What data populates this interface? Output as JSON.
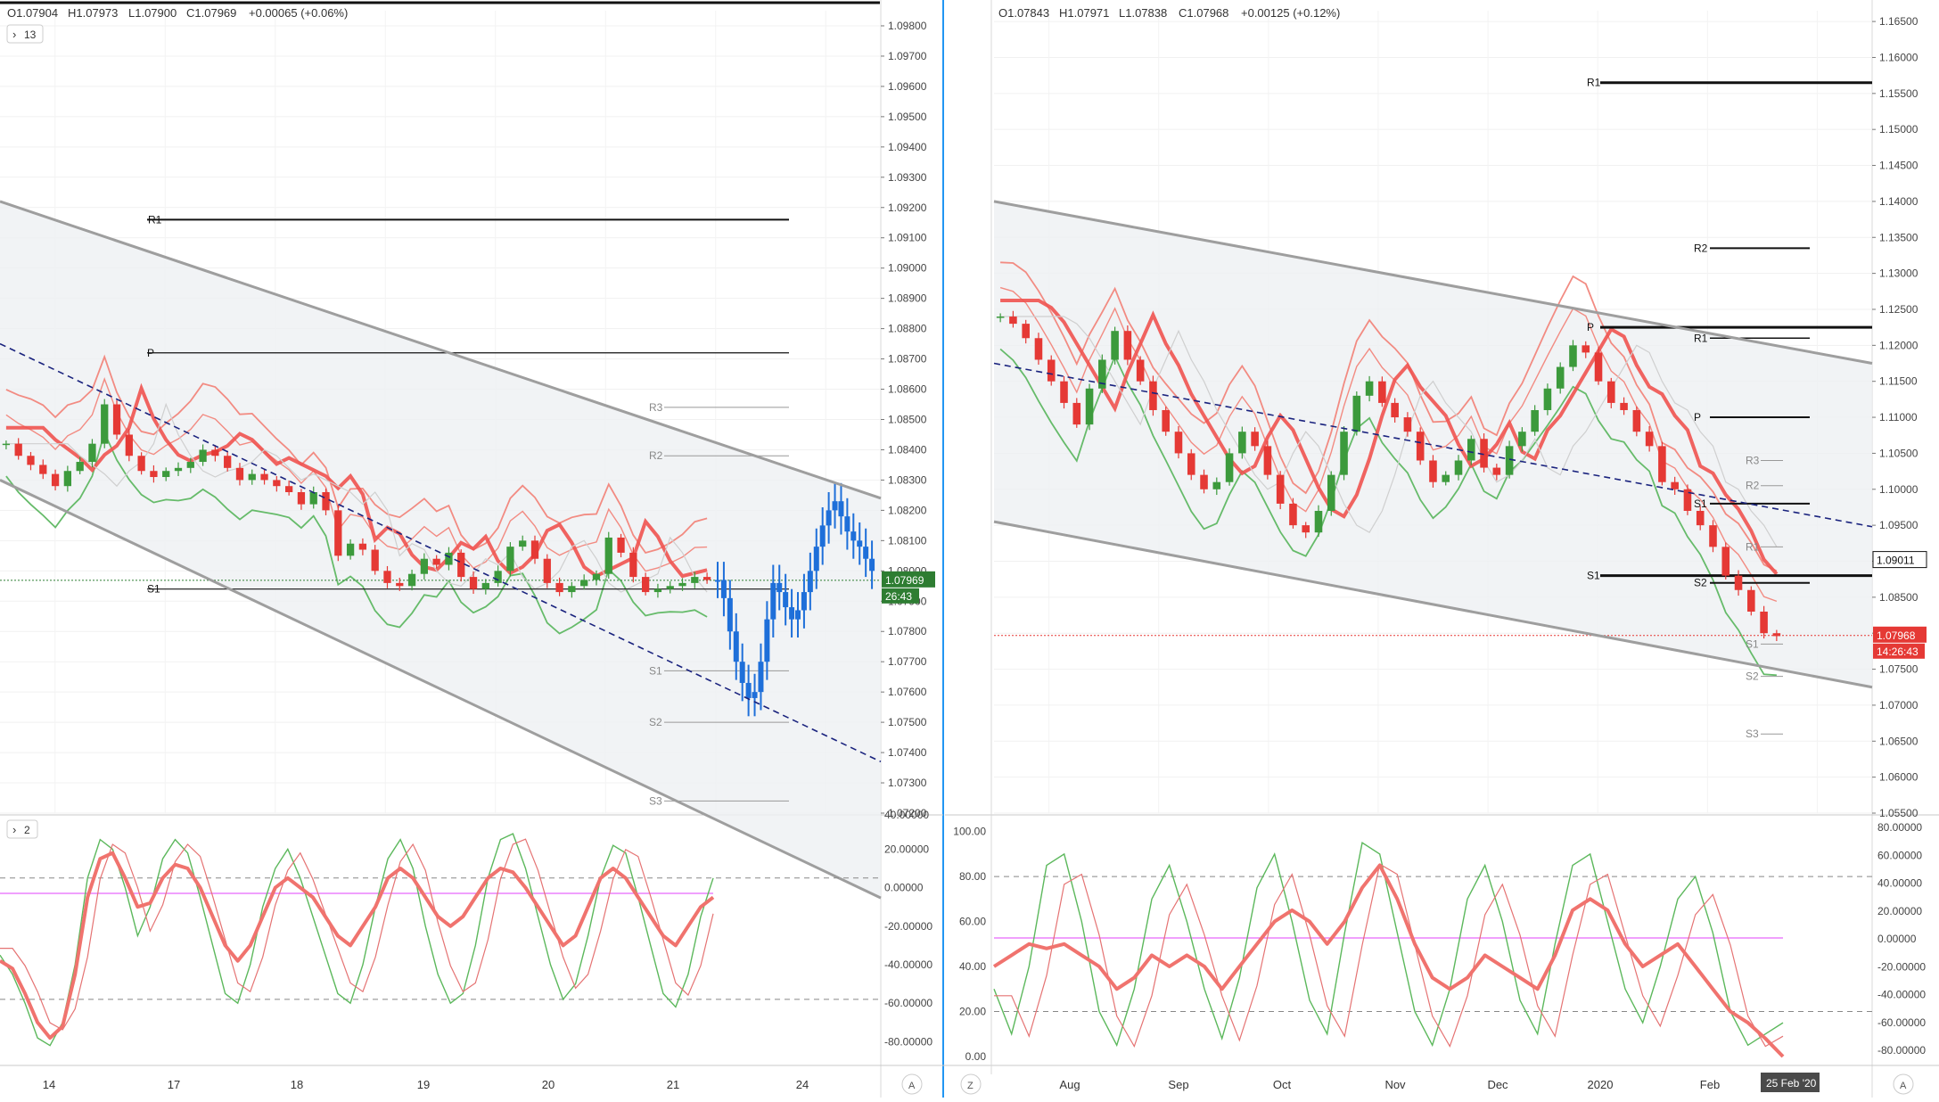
{
  "colors": {
    "bull": "#3c9a3c",
    "bear": "#e53935",
    "blue_bar": "#1e6fd9",
    "ma_red": "#ef5350",
    "band_red": "#f28b82",
    "band_green": "#66bb6a",
    "channel": "#9e9e9e",
    "dashed_trend": "#1a237e",
    "fill": "#eef0f3",
    "osc_fast": "#5cb85c",
    "osc_slow": "#e57373",
    "osc_thick": "#f0736e",
    "last_price_green": "#2e7d32",
    "last_price_red": "#e53935",
    "magenta": "#e040fb"
  },
  "left_panel": {
    "ohlc": {
      "o": "O1.07904",
      "h": "H1.07973",
      "l": "L1.07900",
      "c": "C1.07969",
      "chg": "+0.00065 (+0.06%)"
    },
    "indicator_collapse_label": "13",
    "price_axis_labels": [
      "1.09800",
      "1.09700",
      "1.09600",
      "1.09500",
      "1.09400",
      "1.09300",
      "1.09200",
      "1.09100",
      "1.09000",
      "1.08900",
      "1.08800",
      "1.08700",
      "1.08600",
      "1.08500",
      "1.08400",
      "1.08300",
      "1.08200",
      "1.08100",
      "1.08000",
      "1.07900",
      "1.07800",
      "1.07700",
      "1.07600",
      "1.07500",
      "1.07400",
      "1.07300",
      "1.07200"
    ],
    "last_price": "1.07969",
    "countdown": "26:43",
    "pivot_labels": {
      "r1": "R1",
      "p": "P",
      "s1": "S1",
      "r3": "R3",
      "r2": "R2",
      "s1b": "S1",
      "s2": "S2",
      "s3": "S3"
    },
    "oscillator": {
      "collapse_label": "2",
      "axis_labels": [
        "20.00000",
        "0.00000",
        "-20.00000",
        "-40.00000",
        "-60.00000",
        "-80.00000"
      ],
      "top_edge_label": "40.00000"
    },
    "time_labels": [
      "14",
      "17",
      "18",
      "19",
      "20",
      "21",
      "24"
    ],
    "auto_button": "A"
  },
  "right_panel": {
    "ohlc": {
      "o": "O1.07843",
      "h": "H1.07971",
      "l": "L1.07838",
      "c": "C1.07968",
      "chg": "+0.00125 (+0.12%)"
    },
    "price_axis_labels": [
      "1.16500",
      "1.16000",
      "1.15500",
      "1.15000",
      "1.14500",
      "1.14000",
      "1.13500",
      "1.13000",
      "1.12500",
      "1.12000",
      "1.11500",
      "1.11000",
      "1.10500",
      "1.10000",
      "1.09500",
      "1.09000",
      "1.08500",
      "1.08000",
      "1.07500",
      "1.07000",
      "1.06500",
      "1.06000",
      "1.05500"
    ],
    "marker_price": "1.09011",
    "last_price": "1.07968",
    "countdown": "14:26:43",
    "pivot_labels": {
      "r1": "R1",
      "r2": "R2",
      "p": "P",
      "r1b": "R1",
      "p2": "P",
      "r3": "R3",
      "r2b": "R2",
      "s1": "S1",
      "r1c": "R1",
      "s1b": "S1",
      "s2": "S2",
      "s1c": "S1",
      "s2b": "S2",
      "s3": "S3"
    },
    "oscillator": {
      "left_axis_labels": [
        "100.00",
        "80.00",
        "60.00",
        "40.00",
        "20.00",
        "0.00"
      ],
      "right_axis_labels": [
        "80.00000",
        "60.00000",
        "40.00000",
        "20.00000",
        "0.00000",
        "-20.00000",
        "-40.00000",
        "-60.00000",
        "-80.00000"
      ]
    },
    "time_labels": [
      "Aug",
      "Sep",
      "Oct",
      "Nov",
      "Dec",
      "2020",
      "Feb"
    ],
    "date_marker": "25 Feb '20",
    "z_button": "Z",
    "auto_button": "A"
  },
  "chart_data": [
    {
      "type": "candlestick",
      "title": "",
      "timeframe_labels": [
        "14",
        "17",
        "18",
        "19",
        "20",
        "21",
        "24"
      ],
      "ylim": [
        1.072,
        1.0985
      ],
      "last_price": 1.07969,
      "pivots": {
        "R1": 1.0916,
        "P": 1.0872,
        "S1": 1.0794,
        "R3": 1.0854,
        "R2": 1.0838,
        "S1_weekly": 1.0767,
        "S2": 1.075,
        "S3": 1.0724
      },
      "channel_upper": [
        [
          0.0,
          1.0922
        ],
        [
          1.0,
          1.0824
        ]
      ],
      "channel_lower": [
        [
          0.0,
          1.083
        ],
        [
          1.0,
          1.0692
        ]
      ],
      "trend_dashed": [
        [
          0.0,
          1.0875
        ],
        [
          1.0,
          1.0737
        ]
      ],
      "close_path": [
        1.0842,
        1.0838,
        1.0835,
        1.0832,
        1.0828,
        1.0833,
        1.0836,
        1.0842,
        1.0855,
        1.0845,
        1.0838,
        1.0833,
        1.0831,
        1.0833,
        1.0834,
        1.0836,
        1.084,
        1.0838,
        1.0834,
        1.083,
        1.0832,
        1.083,
        1.0828,
        1.0826,
        1.0822,
        1.0826,
        1.082,
        1.0805,
        1.0809,
        1.0807,
        1.08,
        1.0796,
        1.0795,
        1.0799,
        1.0804,
        1.0802,
        1.0806,
        1.0798,
        1.0794,
        1.0796,
        1.08,
        1.0808,
        1.081,
        1.0804,
        1.0796,
        1.0793,
        1.0795,
        1.0797,
        1.0799,
        1.0811,
        1.0806,
        1.0798,
        1.0793,
        1.0794,
        1.0795,
        1.0796,
        1.0798,
        1.0797
      ],
      "projection_path": [
        1.0797,
        1.0791,
        1.078,
        1.077,
        1.0763,
        1.0758,
        1.076,
        1.077,
        1.0784,
        1.0796,
        1.0793,
        1.0788,
        1.0784,
        1.0787,
        1.0793,
        1.08,
        1.0808,
        1.0815,
        1.082,
        1.0823,
        1.0818,
        1.0813,
        1.081,
        1.0808,
        1.0804,
        1.08
      ],
      "oscillator": {
        "ylim": [
          -90,
          35
        ],
        "levels": [
          5,
          -58
        ],
        "fast": [
          -35,
          -45,
          -60,
          -78,
          -82,
          -70,
          -40,
          5,
          25,
          20,
          0,
          -25,
          -10,
          15,
          25,
          18,
          -5,
          -30,
          -55,
          -60,
          -40,
          -10,
          10,
          20,
          5,
          -15,
          -35,
          -55,
          -60,
          -40,
          -10,
          15,
          25,
          10,
          -20,
          -45,
          -60,
          -55,
          -30,
          5,
          25,
          28,
          10,
          -15,
          -40,
          -58,
          -50,
          -25,
          5,
          22,
          18,
          -5,
          -30,
          -55,
          -62,
          -45,
          -15,
          5
        ],
        "thick": [
          -38,
          -42,
          -55,
          -70,
          -78,
          -72,
          -45,
          -5,
          15,
          18,
          5,
          -10,
          -8,
          5,
          12,
          10,
          0,
          -15,
          -30,
          -38,
          -30,
          -15,
          0,
          5,
          0,
          -5,
          -15,
          -25,
          -30,
          -20,
          -10,
          5,
          10,
          5,
          -5,
          -15,
          -20,
          -15,
          -5,
          5,
          10,
          8,
          0,
          -10,
          -20,
          -30,
          -25,
          -10,
          5,
          10,
          5,
          -5,
          -15,
          -25,
          -30,
          -20,
          -10,
          -5
        ]
      }
    },
    {
      "type": "candlestick",
      "title": "",
      "timeframe_labels": [
        "Aug",
        "Sep",
        "Oct",
        "Nov",
        "Dec",
        "2020",
        "Feb"
      ],
      "ylim": [
        1.055,
        1.1665
      ],
      "last_price": 1.07968,
      "marker_price": 1.09011,
      "pivots": {
        "R1": 1.1565,
        "R2": 1.1335,
        "P": 1.1225,
        "R1_monthly": 1.121,
        "P_weekly": 1.11,
        "R3": 1.104,
        "R2_weekly": 1.1005,
        "S1": 1.098,
        "R1_weekly": 1.092,
        "S1_big": 1.088,
        "S2": 1.087,
        "S1_weekly": 1.0785,
        "S2_weekly": 1.074,
        "S3": 1.066
      },
      "channel_upper": [
        [
          0.0,
          1.14
        ],
        [
          1.0,
          1.1175
        ]
      ],
      "channel_lower": [
        [
          0.0,
          1.0955
        ],
        [
          1.0,
          1.0725
        ]
      ],
      "trend_dashed": [
        [
          0.0,
          1.1175
        ],
        [
          1.0,
          1.0948
        ]
      ],
      "close_path": [
        1.124,
        1.123,
        1.121,
        1.118,
        1.115,
        1.112,
        1.109,
        1.114,
        1.118,
        1.122,
        1.118,
        1.115,
        1.111,
        1.108,
        1.105,
        1.102,
        1.1,
        1.101,
        1.105,
        1.108,
        1.106,
        1.102,
        1.098,
        1.095,
        1.094,
        1.097,
        1.102,
        1.108,
        1.113,
        1.115,
        1.112,
        1.11,
        1.108,
        1.104,
        1.101,
        1.102,
        1.104,
        1.107,
        1.103,
        1.102,
        1.106,
        1.108,
        1.111,
        1.114,
        1.117,
        1.12,
        1.119,
        1.115,
        1.112,
        1.111,
        1.108,
        1.106,
        1.101,
        1.1,
        1.097,
        1.095,
        1.092,
        1.088,
        1.086,
        1.083,
        1.08,
        1.0796
      ],
      "oscillator": {
        "ylim": [
          -2,
          105
        ],
        "levels": [
          80,
          20
        ],
        "fast": [
          30,
          10,
          40,
          85,
          90,
          60,
          20,
          5,
          30,
          70,
          85,
          60,
          30,
          8,
          35,
          75,
          90,
          60,
          25,
          10,
          55,
          95,
          90,
          55,
          20,
          5,
          30,
          70,
          85,
          60,
          25,
          10,
          50,
          85,
          90,
          60,
          30,
          15,
          40,
          70,
          80,
          55,
          20,
          5,
          10,
          15
        ],
        "thick": [
          40,
          45,
          50,
          48,
          50,
          45,
          40,
          30,
          35,
          45,
          40,
          45,
          40,
          30,
          40,
          50,
          60,
          65,
          60,
          50,
          60,
          75,
          85,
          70,
          50,
          35,
          30,
          35,
          45,
          40,
          35,
          30,
          45,
          65,
          70,
          65,
          50,
          40,
          45,
          50,
          40,
          30,
          20,
          15,
          8,
          0
        ]
      }
    }
  ]
}
